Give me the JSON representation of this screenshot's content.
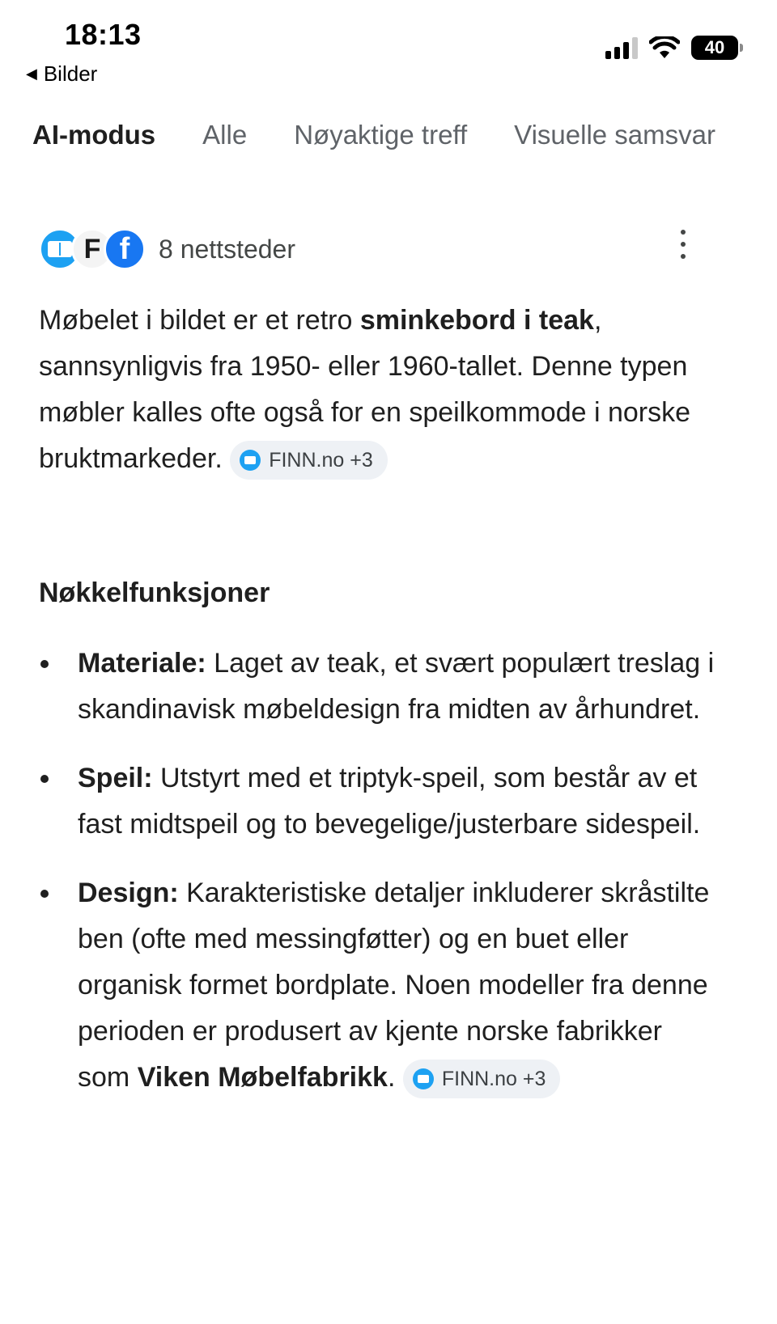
{
  "status_bar": {
    "time": "18:13",
    "back_label": "Bilder",
    "battery": "40"
  },
  "tabs": [
    {
      "label": "AI-modus",
      "active": true
    },
    {
      "label": "Alle",
      "active": false
    },
    {
      "label": "Nøyaktige treff",
      "active": false
    },
    {
      "label": "Visuelle samsvar",
      "active": false
    }
  ],
  "sources": {
    "label": "8 nettsteder",
    "icons": [
      "finn-icon",
      "fj-icon",
      "facebook-icon"
    ]
  },
  "summary": {
    "part1": "Møbelet i bildet er et retro ",
    "bold": "sminkebord i teak",
    "part2": ", sannsynligvis fra 1950- eller 1960-tallet. Denne typen møbler kalles ofte også for en speilkommode i norske bruktmarkeder.",
    "chip": "FINN.no +3"
  },
  "section_title": "Nøkkelfunksjoner",
  "features": {
    "material": {
      "term": "Materiale:",
      "text": " Laget av teak, et svært populært treslag i skandinavisk møbeldesign fra midten av århundret."
    },
    "mirror": {
      "term": "Speil:",
      "text": " Utstyrt med et triptyk-speil, som består av et fast midtspeil og to bevegelige/justerbare sidespeil."
    },
    "design": {
      "term": "Design:",
      "text": " Karakteristiske detaljer inkluderer skråstilte ben (ofte med messingføtter) og en buet eller organisk formet bordplate. Noen modeller fra denne perioden er produsert av kjente norske fabrikker som ",
      "bold_end": "Viken Møbelfabrikk",
      "end": ".",
      "chip": "FINN.no +3"
    }
  }
}
